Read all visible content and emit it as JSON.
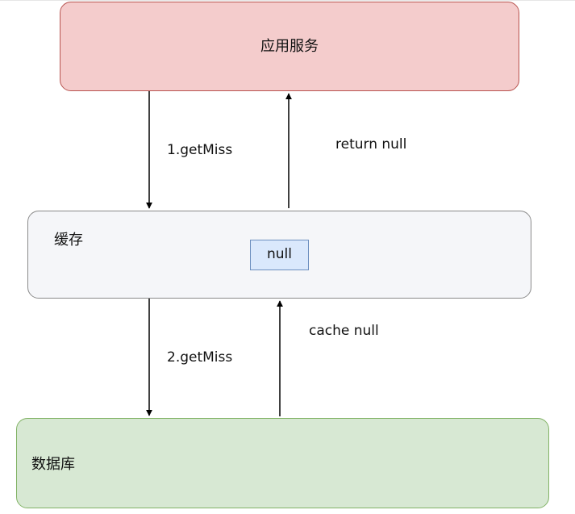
{
  "nodes": {
    "app_service": {
      "label": "应用服务",
      "fill": "#f4cccc",
      "stroke": "#b85450"
    },
    "cache": {
      "label": "缓存",
      "value_chip": "null",
      "fill": "#f5f6f9",
      "stroke": "#8a8a8a",
      "chip_fill": "#dae8fc",
      "chip_stroke": "#6c8ebf"
    },
    "database": {
      "label": "数据库",
      "fill": "#d7e8d3",
      "stroke": "#82b366"
    }
  },
  "edges": {
    "app_to_cache": {
      "label": "1.getMiss",
      "direction": "down"
    },
    "cache_to_app": {
      "label": "return null",
      "direction": "up"
    },
    "cache_to_db": {
      "label": "2.getMiss",
      "direction": "down"
    },
    "db_to_cache": {
      "label": "cache null",
      "direction": "up"
    }
  }
}
